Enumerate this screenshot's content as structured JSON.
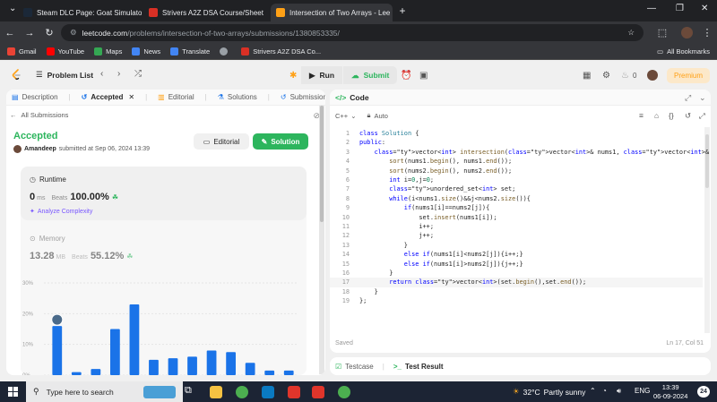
{
  "browser": {
    "tabs": [
      {
        "label": "Steam DLC Page: Goat Simulato",
        "fav_color": "#1b2838"
      },
      {
        "label": "Strivers A2Z DSA Course/Sheet",
        "fav_color": "#d93025"
      },
      {
        "label": "Intersection of Two Arrays - Lee",
        "fav_color": "#ffa116"
      }
    ],
    "new_tab": "+",
    "window_controls": [
      "⌄",
      "—",
      "❐",
      "✕"
    ],
    "url_host": "leetcode.com",
    "url_path": "/problems/intersection-of-two-arrays/submissions/1380853335/",
    "bookmarks": [
      {
        "label": "Gmail",
        "color": "#ea4335"
      },
      {
        "label": "YouTube",
        "color": "#ff0000"
      },
      {
        "label": "Maps",
        "color": "#34a853"
      },
      {
        "label": "News",
        "color": "#4285f4"
      },
      {
        "label": "Translate",
        "color": "#4285f4"
      },
      {
        "label": "",
        "color": "#9aa0a6"
      },
      {
        "label": "Strivers A2Z DSA Co...",
        "color": "#d93025"
      }
    ],
    "all_bookmarks": "All Bookmarks"
  },
  "header": {
    "problem_list": "Problem List",
    "run": "Run",
    "submit": "Submit",
    "streak_count": "0",
    "premium": "Premium"
  },
  "left": {
    "tabs": [
      {
        "label": "Description",
        "icon": "▤"
      },
      {
        "label": "Accepted",
        "icon": "↺"
      },
      {
        "label": "Editorial",
        "icon": "▥"
      },
      {
        "label": "Solutions",
        "icon": "⚗"
      },
      {
        "label": "Submissions",
        "icon": "↺"
      }
    ],
    "tab_close": "✕",
    "all_submissions": "All Submissions",
    "status": "Accepted",
    "author": "Amandeep",
    "submitted_at": "submitted at Sep 06, 2024 13:39",
    "editorial_btn": "Editorial",
    "solution_btn": "Solution",
    "runtime_title": "Runtime",
    "runtime_value": "0",
    "runtime_unit": "ms",
    "beats_label": "Beats",
    "runtime_beats": "100.00%",
    "analyze": "Analyze Complexity",
    "memory_title": "Memory",
    "memory_value": "13.28",
    "memory_unit": "MB",
    "memory_beats": "55.12%"
  },
  "chart_data": {
    "type": "bar",
    "ytick_labels": [
      "30%",
      "20%",
      "10%",
      "0%"
    ],
    "ylim": [
      0,
      30
    ],
    "values": [
      16,
      1,
      2,
      15,
      23,
      5,
      5.5,
      6,
      8,
      7.5,
      4,
      1.5,
      1.5
    ],
    "highlight_index": 0,
    "bar_color": "#1a73e8"
  },
  "code": {
    "title": "Code",
    "language": "C++",
    "mode": "Auto",
    "status": "Saved",
    "cursor": "Ln 17, Col 51",
    "lines": [
      "class Solution {",
      "public:",
      "    vector<int> intersection(vector<int>& nums1, vector<int>& nums2) {",
      "        sort(nums1.begin(), nums1.end());",
      "        sort(nums2.begin(), nums2.end());",
      "        int i=0,j=0;",
      "        unordered_set<int> set;",
      "        while(i<nums1.size()&&j<nums2.size()){",
      "            if(nums1[i]==nums2[j]){",
      "                set.insert(nums1[i]);",
      "                i++;",
      "                j++;",
      "            }",
      "            else if(nums1[i]<nums2[j]){i++;}",
      "            else if(nums1[i]>nums2[j]){j++;}",
      "        }",
      "        return vector<int>(set.begin(),set.end());",
      "    }",
      "};"
    ],
    "current_line": 17
  },
  "testpanel": {
    "testcase": "Testcase",
    "result": "Test Result"
  },
  "taskbar": {
    "search": "Type here to search",
    "temp": "32°C",
    "weather": "Partly sunny",
    "lang": "ENG",
    "time": "13:39",
    "date": "06-09-2024",
    "notifications": "24"
  }
}
